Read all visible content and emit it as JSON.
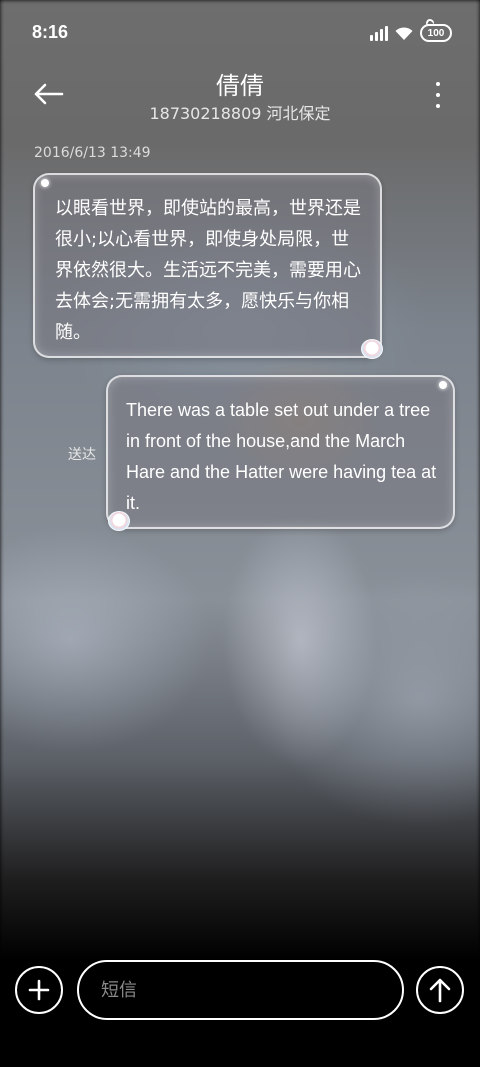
{
  "status_bar": {
    "time": "8:16",
    "battery": "100",
    "icons": [
      "signal-icon",
      "wifi-icon",
      "battery-icon"
    ]
  },
  "header": {
    "title": "倩倩",
    "subtitle": "18730218809 河北保定",
    "back_icon": "back-arrow-icon",
    "more_icon": "more-vertical-icon"
  },
  "conversation": {
    "timestamp": "2016/6/13 13:49",
    "messages": [
      {
        "direction": "incoming",
        "text": "以眼看世界，即使站的最高，世界还是很小;以心看世界，即使身处局限，世界依然很大。生活远不完美，需要用心去体会;无需拥有太多，愿快乐与你相随。"
      },
      {
        "direction": "outgoing",
        "text": "There was a table set out under a tree in front of the house,and the March Hare and the Hatter were having tea at it.",
        "status": "送达"
      }
    ]
  },
  "composer": {
    "placeholder": "短信",
    "add_icon": "plus-icon",
    "send_icon": "send-arrow-up-icon"
  },
  "colors": {
    "text": "#ffffff",
    "bubble_border": "#ffffff",
    "background_bottom": "#000000"
  }
}
